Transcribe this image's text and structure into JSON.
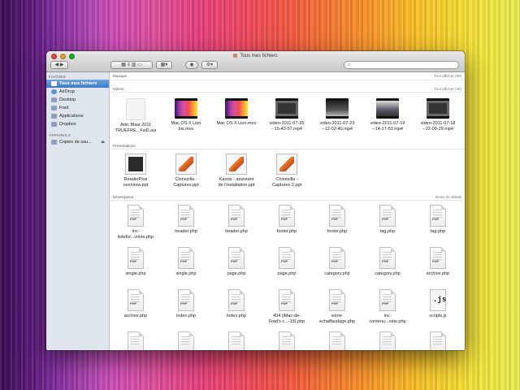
{
  "window": {
    "title": "Tous mes fichiers"
  },
  "toolbar": {
    "search_placeholder": "",
    "back_label": "◀ ▶",
    "view_label": "▦ ≡ ▥ ▭",
    "arrange_label": "▦▾",
    "action_label": "⚙▾"
  },
  "sidebar": {
    "favorites_header": "FAVORIS",
    "items": [
      {
        "label": "Tous mes fichiers",
        "icon": "all-files-icon"
      },
      {
        "label": "AirDrop",
        "icon": "airdrop-icon"
      },
      {
        "label": "Desktop",
        "icon": "desktop-icon"
      },
      {
        "label": "Fred",
        "icon": "home-icon"
      },
      {
        "label": "Applications",
        "icon": "applications-icon"
      },
      {
        "label": "Dropbox",
        "icon": "dropbox-icon"
      }
    ],
    "devices_header": "APPAREILS",
    "devices": [
      {
        "label": "Copies de sau...",
        "icon": "backup-disk-icon"
      }
    ]
  },
  "sections": {
    "music": {
      "title": "Musique",
      "action": "Tout afficher (90)"
    },
    "videos": {
      "title": "Vidéos",
      "action": "Tout afficher (48)",
      "files": [
        {
          "name1": "Artic Blast 2011",
          "name2": "TRUEFRE...FwD.avi",
          "thumb": "blank"
        },
        {
          "name1": "Mac OS X Lion",
          "name2": "bis.mov",
          "thumb": "stripe"
        },
        {
          "name1": "Mac OS X Lion.mov",
          "name2": "",
          "thumb": "stripe"
        },
        {
          "name1": "video-2011-07-25",
          "name2": "--15-43-57.mp4",
          "thumb": "ipad"
        },
        {
          "name1": "video-2011-07-23",
          "name2": "--12-02-40.mp4",
          "thumb": "dark"
        },
        {
          "name1": "video-2011-07-19",
          "name2": "--14-17-53.mp4",
          "thumb": "scene"
        },
        {
          "name1": "video-2011-07-18",
          "name2": "--22-09-29.mp4",
          "thumb": "ipad"
        }
      ]
    },
    "presentations": {
      "title": "Présentations",
      "files": [
        {
          "name1": "ReaderPlus",
          "name2": "overview.ppt",
          "thumb": "dark"
        },
        {
          "name1": "Clonezilla -",
          "name2": "Captures.ppt",
          "thumb": "clone"
        },
        {
          "name1": "Karotz - assistant",
          "name2": "de l'installation.ppt",
          "thumb": "clone"
        },
        {
          "name1": "Clonezilla -",
          "name2": "Captures 2.ppt",
          "thumb": "clone"
        }
      ]
    },
    "developer": {
      "title": "Développeur",
      "action": "Moins de détails",
      "rows": [
        [
          {
            "name1": "inc-",
            "name2": "listefor...voirie.php",
            "type": "php"
          },
          {
            "name1": "header.php",
            "name2": "",
            "type": "php"
          },
          {
            "name1": "header.php",
            "name2": "",
            "type": "php"
          },
          {
            "name1": "footer.php",
            "name2": "",
            "type": "php"
          },
          {
            "name1": "footer.php",
            "name2": "",
            "type": "php"
          },
          {
            "name1": "tag.php",
            "name2": "",
            "type": "php"
          },
          {
            "name1": "tag.php",
            "name2": "",
            "type": "php"
          }
        ],
        [
          {
            "name1": "single.php",
            "name2": "",
            "type": "php"
          },
          {
            "name1": "single.php",
            "name2": "",
            "type": "php"
          },
          {
            "name1": "page.php",
            "name2": "",
            "type": "php"
          },
          {
            "name1": "page.php",
            "name2": "",
            "type": "php"
          },
          {
            "name1": "category.php",
            "name2": "",
            "type": "php"
          },
          {
            "name1": "category.php",
            "name2": "",
            "type": "php"
          },
          {
            "name1": "archive.php",
            "name2": "",
            "type": "php"
          }
        ],
        [
          {
            "name1": "archive.php",
            "name2": "",
            "type": "php"
          },
          {
            "name1": "index.php",
            "name2": "",
            "type": "php"
          },
          {
            "name1": "index.php",
            "name2": "",
            "type": "php"
          },
          {
            "name1": "404 (iMac-de-",
            "name2": "Fred's c...-19).php",
            "type": "php"
          },
          {
            "name1": "voirie-",
            "name2": "echaffaudage.php",
            "type": "php"
          },
          {
            "name1": "inc-",
            "name2": "contenu...oirie.php",
            "type": "php"
          },
          {
            "name1": "scripts.js",
            "name2": "",
            "type": "js"
          }
        ]
      ]
    }
  },
  "icon_tag": {
    "php": "PHP",
    "js": ".js"
  }
}
